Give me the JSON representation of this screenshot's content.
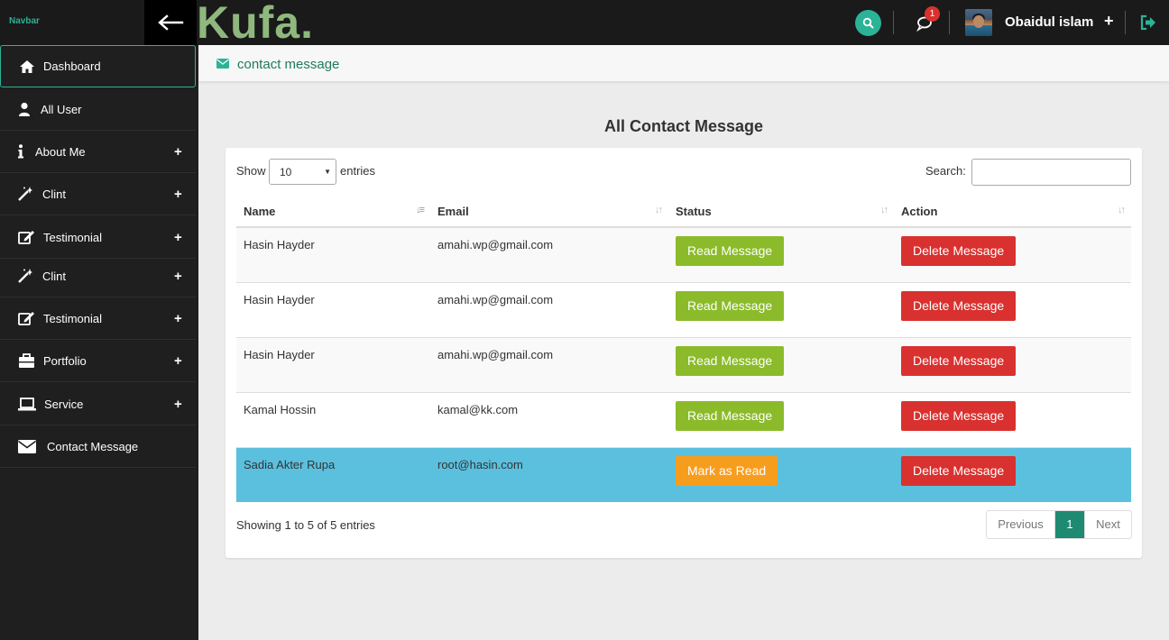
{
  "topbar": {
    "brand_label": "Navbar",
    "logo": "Kufa.",
    "notification_count": "1",
    "user_name": "Obaidul islam",
    "plus": "+"
  },
  "sidebar": {
    "items": [
      {
        "label": "Dashboard",
        "icon": "home-icon",
        "expandable": false,
        "active": true
      },
      {
        "label": "All User",
        "icon": "user-icon",
        "expandable": false
      },
      {
        "label": "About Me",
        "icon": "info-icon",
        "expandable": true
      },
      {
        "label": "Clint",
        "icon": "magic-wand-icon",
        "expandable": true
      },
      {
        "label": "Testimonial",
        "icon": "edit-icon",
        "expandable": true
      },
      {
        "label": "Clint",
        "icon": "magic-wand-icon",
        "expandable": true
      },
      {
        "label": "Testimonial",
        "icon": "edit-icon",
        "expandable": true
      },
      {
        "label": "Portfolio",
        "icon": "briefcase-icon",
        "expandable": true
      },
      {
        "label": "Service",
        "icon": "laptop-icon",
        "expandable": true
      },
      {
        "label": "Contact Message",
        "icon": "envelope-icon",
        "expandable": false
      }
    ],
    "plus": "+"
  },
  "page_header": {
    "title": "contact message"
  },
  "main": {
    "title": "All Contact Message"
  },
  "table_controls": {
    "show_label": "Show",
    "entries_label": "entries",
    "page_length": "10",
    "search_label": "Search:",
    "search_value": ""
  },
  "table": {
    "headers": [
      "Name",
      "Email",
      "Status",
      "Action"
    ],
    "rows": [
      {
        "name": "Hasin Hayder",
        "email": "amahi.wp@gmail.com",
        "status": "Read Message",
        "action": "Delete Message"
      },
      {
        "name": "Hasin Hayder",
        "email": "amahi.wp@gmail.com",
        "status": "Read Message",
        "action": "Delete Message"
      },
      {
        "name": "Hasin Hayder",
        "email": "amahi.wp@gmail.com",
        "status": "Read Message",
        "action": "Delete Message"
      },
      {
        "name": "Kamal Hossin",
        "email": "kamal@kk.com",
        "status": "Read Message",
        "action": "Delete Message"
      },
      {
        "name": "Sadia Akter Rupa",
        "email": "root@hasin.com",
        "status": "Mark as Read",
        "action": "Delete Message"
      }
    ]
  },
  "footer": {
    "info": "Showing 1 to 5 of 5 entries",
    "prev": "Previous",
    "current_page": "1",
    "next": "Next"
  },
  "colors": {
    "accent": "#2bb397",
    "read_button": "#8bbb2a",
    "delete_button": "#d9312f",
    "unread_button": "#f79d1e",
    "highlight_row": "#5bc0de"
  }
}
